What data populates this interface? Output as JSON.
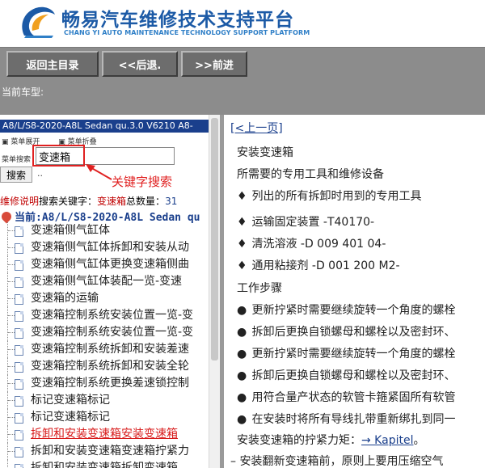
{
  "header": {
    "title": "畅易汽车维修技术支持平台",
    "subtitle": "CHANG YI AUTO MAINTENANCE TECHNOLOGY SUPPORT PLATFORM"
  },
  "nav": {
    "home_label": "返回主目录",
    "back_label": "<<后退.",
    "forward_label": ">>前进"
  },
  "model_bar": {
    "label": "当前车型:"
  },
  "left": {
    "model_title": "A8/L/S8-2020-A8L Sedan qu.3.0 V6210 A8-",
    "menu_expand": "菜单展开",
    "menu_collapse": "菜单折叠",
    "search_label": "菜单搜索",
    "search_value": "变速箱",
    "search_button": "搜索",
    "dots": "..",
    "annotation": "关键字搜索",
    "info_prefix": "维修说明",
    "info_mid": "搜索关键字：",
    "info_keyword": "变速箱",
    "info_count_label": "总数量：",
    "info_count": "31",
    "current_label": "当前:A8/L/S8-2020-A8L Sedan qu",
    "tree": [
      "变速箱侧气缸体",
      "变速箱侧气缸体拆卸和安装从动",
      "变速箱侧气缸体更换变速箱侧曲",
      "变速箱侧气缸体装配一览-变速",
      "变速箱的运输",
      "变速箱控制系统安装位置一览-变",
      "变速箱控制系统安装位置一览-变",
      "变速箱控制系统拆卸和安装差速",
      "变速箱控制系统拆卸和安装全轮",
      "变速箱控制系统更换差速锁控制",
      "标记变速箱标记",
      "标记变速箱标记",
      "拆卸和安装变速箱安装变速箱",
      "拆卸和安装变速箱变速箱拧紧力",
      "拆卸和安装变速箱拆卸变速箱"
    ],
    "selected_index": 12
  },
  "right": {
    "prev_link": "[<上一页]",
    "title": "安装变速箱",
    "tools_heading": "所需要的专用工具和维修设备",
    "tools": [
      "列出的所有拆卸时用到的专用工具",
      "运输固定装置 -T40170-",
      "清洗溶液 -D 009 401 04-",
      "通用粘接剂 -D 001 200 M2-"
    ],
    "steps_heading": "工作步骤",
    "steps": [
      "更新拧紧时需要继续旋转一个角度的螺栓",
      "拆卸后更换自锁螺母和螺栓以及密封环、",
      "更新拧紧时需要继续旋转一个角度的螺栓",
      "拆卸后更换自锁螺母和螺栓以及密封环、",
      "用符合量产状态的软管卡箍紧固所有软管",
      "在安装时将所有导线扎带重新绑扎到同一"
    ],
    "torque_prefix": "安装变速箱的拧紧力矩：",
    "torque_link": "→ Kapitel",
    "torque_suffix": "。",
    "last_line": "–  安装翻新变速箱前，原则上要用压缩空气"
  },
  "colors": {
    "brand_blue": "#1c5aa6",
    "toolbar_gray": "#8c8c8c",
    "highlight_red": "#e02020"
  }
}
